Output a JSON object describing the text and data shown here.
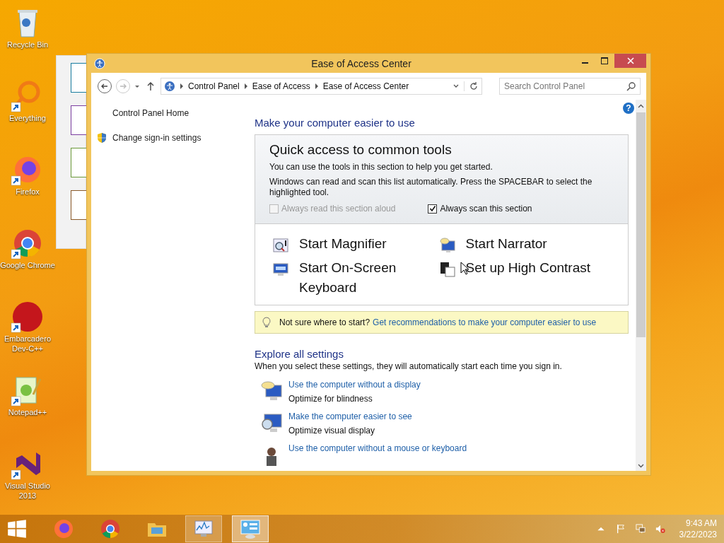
{
  "desktop_icons": [
    {
      "label": "Recycle Bin",
      "shortcut": false
    },
    {
      "label": "Everything",
      "shortcut": true
    },
    {
      "label": "Firefox",
      "shortcut": true
    },
    {
      "label": "Google Chrome",
      "shortcut": true
    },
    {
      "label": "Embarcadero Dev-C++",
      "shortcut": true
    },
    {
      "label": "Notepad++",
      "shortcut": true
    },
    {
      "label": "Visual Studio 2013",
      "shortcut": true
    }
  ],
  "window": {
    "title": "Ease of Access Center",
    "breadcrumb": [
      "Control Panel",
      "Ease of Access",
      "Ease of Access Center"
    ],
    "search": {
      "placeholder": "Search Control Panel"
    },
    "sidebar": [
      {
        "label": "Control Panel Home",
        "shield": false
      },
      {
        "label": "Change sign-in settings",
        "shield": true
      }
    ],
    "help": "?",
    "heading": "Make your computer easier to use",
    "quick_access": {
      "title": "Quick access to common tools",
      "lines": [
        "You can use the tools in this section to help you get started.",
        "Windows can read and scan this list automatically.  Press the SPACEBAR to select the highlighted tool."
      ],
      "checkboxes": [
        {
          "label": "Always read this section aloud",
          "checked": false,
          "disabled": true
        },
        {
          "label": "Always scan this section",
          "checked": true,
          "disabled": false
        }
      ],
      "tools": [
        {
          "label": "Start Magnifier",
          "kind": "magnifier"
        },
        {
          "label": "Start Narrator",
          "kind": "narrator"
        },
        {
          "label": "Start On-Screen Keyboard",
          "kind": "keyboard"
        },
        {
          "label": "Set up High Contrast",
          "kind": "contrast"
        }
      ]
    },
    "tip": {
      "text": "Not sure where to start?",
      "link": "Get recommendations to make your computer easier to use"
    },
    "explore": {
      "title": "Explore all settings",
      "subtitle": "When you select these settings, they will automatically start each time you sign in.",
      "items": [
        {
          "link": "Use the computer without a display",
          "description": "Optimize for blindness",
          "kind": "display"
        },
        {
          "link": "Make the computer easier to see",
          "description": "Optimize visual display",
          "kind": "see"
        },
        {
          "link": "Use the computer without a mouse or keyboard",
          "kind": "person"
        }
      ]
    }
  },
  "taskbar": {
    "apps": [
      {
        "kind": "firefox",
        "running": false,
        "selected": false
      },
      {
        "kind": "chrome",
        "running": false,
        "selected": false
      },
      {
        "kind": "explorer",
        "running": false,
        "selected": false
      },
      {
        "kind": "monitor",
        "running": true,
        "selected": false
      },
      {
        "kind": "control-panel",
        "running": true,
        "selected": true
      }
    ],
    "time": "9:43 AM",
    "date": "3/22/2023"
  }
}
